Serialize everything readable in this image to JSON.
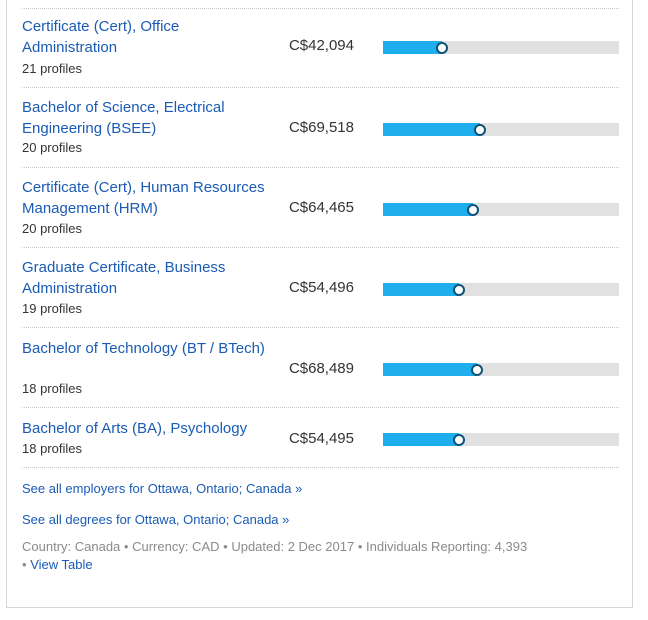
{
  "degrees": [
    {
      "name": "Certificate (Cert), Office Administration",
      "profiles": "21 profiles",
      "salary": "C$42,094",
      "level": 0.25
    },
    {
      "name": "Bachelor of Science, Electrical Engineering (BSEE)",
      "profiles": "20 profiles",
      "salary": "C$69,518",
      "level": 0.41
    },
    {
      "name": "Certificate (Cert), Human Resources Management (HRM)",
      "profiles": "20 profiles",
      "salary": "C$64,465",
      "level": 0.38
    },
    {
      "name": "Graduate Certificate, Business Administration",
      "profiles": "19 profiles",
      "salary": "C$54,496",
      "level": 0.32
    },
    {
      "name": "Bachelor of Technology (BT / BTech)",
      "profiles": "18 profiles",
      "salary": "C$68,489",
      "level": 0.4
    },
    {
      "name": "Bachelor of Arts (BA), Psychology",
      "profiles": "18 profiles",
      "salary": "C$54,495",
      "level": 0.32
    }
  ],
  "links": {
    "employers": "See all employers for Ottawa, Ontario; Canada »",
    "degrees": "See all degrees for Ottawa, Ontario; Canada »"
  },
  "footer": {
    "country": "Country: Canada",
    "currency": "Currency: CAD",
    "updated": "Updated: 2 Dec 2017",
    "reporting": "Individuals Reporting: 4,393",
    "view_table": "View Table",
    "separator": "•"
  },
  "colors": {
    "link": "#1a5bb5",
    "bar_fill": "#1eaeed",
    "bar_track": "#e1e1e1",
    "knob_border": "#0d5377"
  }
}
